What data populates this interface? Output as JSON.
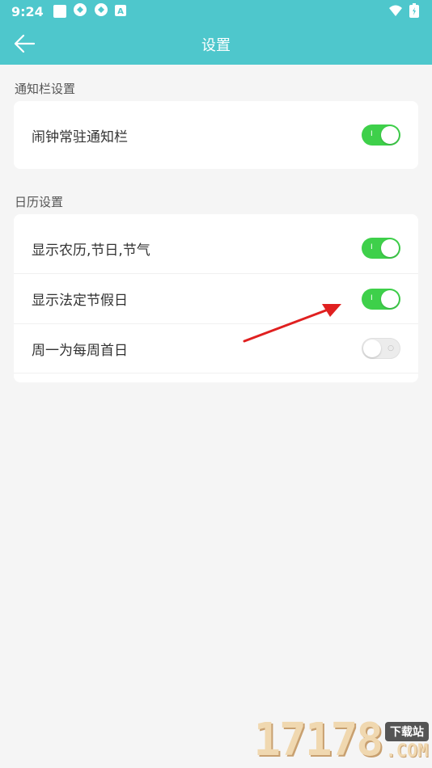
{
  "status_bar": {
    "time": "9:24",
    "icons": [
      "square-icon",
      "sync-icon",
      "sync-icon",
      "text-a-icon",
      "wifi-icon",
      "battery-icon"
    ],
    "indicator_text": "A"
  },
  "toolbar": {
    "title": "设置",
    "back_icon": "arrow-left-icon",
    "background": "#4ec7cc"
  },
  "sections": [
    {
      "label": "通知栏设置",
      "items": [
        {
          "label": "闹钟常驻通知栏",
          "enabled": true
        }
      ]
    },
    {
      "label": "日历设置",
      "items": [
        {
          "label": "显示农历,节日,节气",
          "enabled": true
        },
        {
          "label": "显示法定节假日",
          "enabled": true
        },
        {
          "label": "周一为每周首日",
          "enabled": false
        }
      ]
    }
  ],
  "toggle_marks": {
    "on": "I",
    "off": "O"
  },
  "colors": {
    "toggle_on": "#3ed04a",
    "toggle_off": "#ececec",
    "annotation_arrow": "#e02020"
  },
  "watermark": {
    "digits": "17178",
    "badge": "下载站",
    "domain": ".COM"
  }
}
